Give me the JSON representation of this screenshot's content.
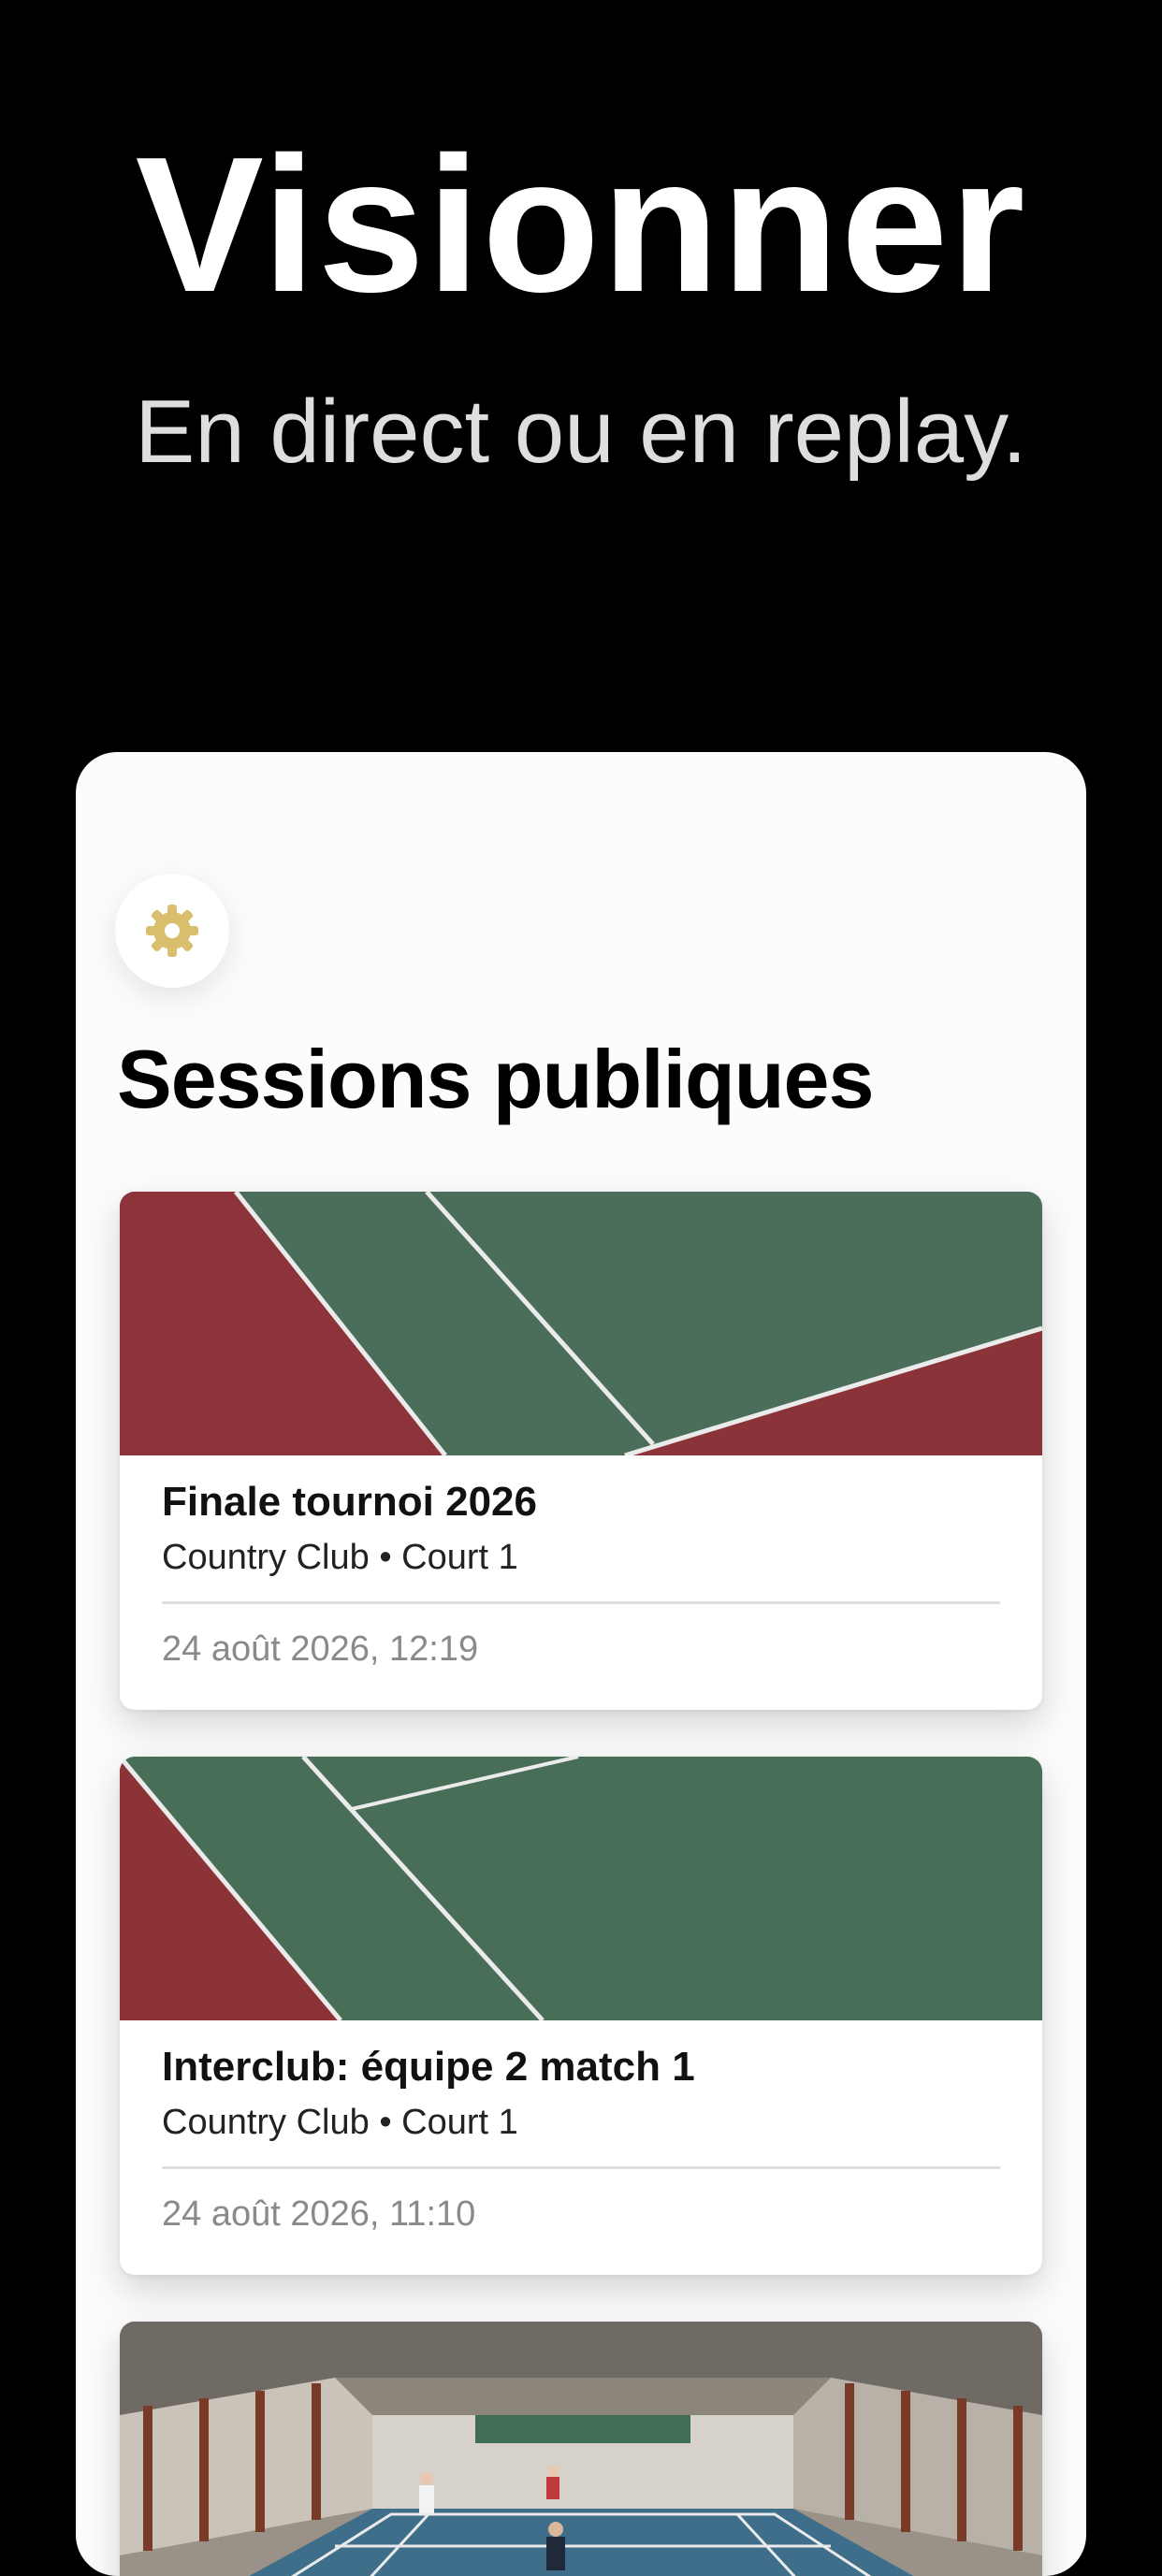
{
  "hero": {
    "title": "Visionner",
    "subtitle": "En direct ou en replay."
  },
  "settings": {
    "icon": "gear-icon",
    "color": "#d9bf6d"
  },
  "sessions": {
    "title": "Sessions publiques",
    "items": [
      {
        "title": "Finale tournoi 2026",
        "club": "Country Club",
        "separator": "•",
        "court": "Court 1",
        "subtitle": "Country Club • Court 1",
        "date": "24 août 2026, 12:19"
      },
      {
        "title": "Interclub: équipe 2 match 1",
        "club": "Country Club",
        "separator": "•",
        "court": "Court 1",
        "subtitle": "Country Club • Court 1",
        "date": "24 août 2026, 11:10"
      }
    ]
  },
  "colors": {
    "background": "#000000",
    "card": "#fcfcfc",
    "court_green": "#496e58",
    "court_red": "#8c3338",
    "accent_gold": "#d9bf6d"
  }
}
